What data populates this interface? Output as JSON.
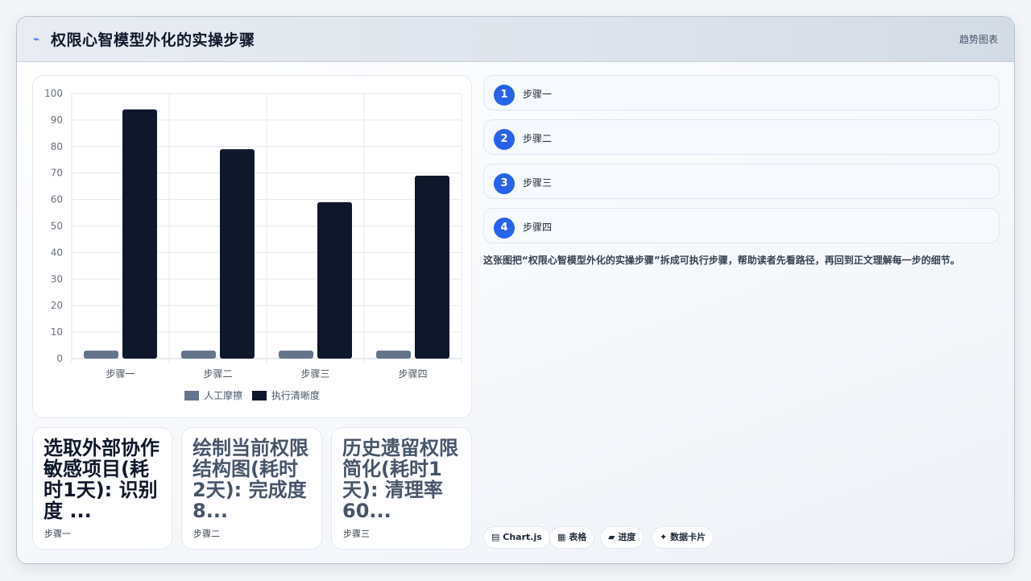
{
  "header": {
    "title": "权限心智模型外化的实操步骤",
    "tag": "趋势图表",
    "icon": "spark-icon"
  },
  "chart_data": {
    "type": "bar",
    "categories": [
      "步骤一",
      "步骤二",
      "步骤三",
      "步骤四"
    ],
    "series": [
      {
        "name": "人工摩擦",
        "values": [
          3,
          3,
          3,
          3
        ],
        "color": "#64748b"
      },
      {
        "name": "执行清晰度",
        "values": [
          94,
          79,
          59,
          69
        ],
        "color": "#0f172a"
      }
    ],
    "ylim": [
      0,
      100
    ],
    "yticks": [
      0,
      10,
      20,
      30,
      40,
      50,
      60,
      70,
      80,
      90,
      100
    ],
    "grid": true,
    "legend": "bottom"
  },
  "cards": [
    {
      "text": "选取外部协作敏感项目(耗时1天): 识别度 ...",
      "caption": "步骤一",
      "color": "#0f172a"
    },
    {
      "text": "绘制当前权限结构图(耗时2天): 完成度 8...",
      "caption": "步骤二",
      "color": "#475569"
    },
    {
      "text": "历史遗留权限简化(耗时1天): 清理率 60...",
      "caption": "步骤三",
      "color": "#475569"
    }
  ],
  "steps": [
    {
      "num": "1",
      "label": "步骤一"
    },
    {
      "num": "2",
      "label": "步骤二"
    },
    {
      "num": "3",
      "label": "步骤三"
    },
    {
      "num": "4",
      "label": "步骤四"
    }
  ],
  "description": "这张图把“权限心智模型外化的实操步骤”拆成可执行步骤，帮助读者先看路径，再回到正文理解每一步的细节。",
  "pills": [
    {
      "icon": "▤",
      "label": "Chart.js"
    },
    {
      "icon": "▦",
      "label": "表格"
    },
    {
      "icon": "▰",
      "label": "进度"
    },
    {
      "icon": "✦",
      "label": "数据卡片"
    }
  ]
}
